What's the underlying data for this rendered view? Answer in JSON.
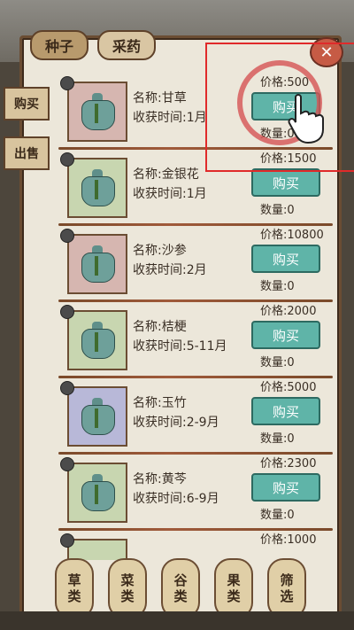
{
  "tabs": [
    {
      "label": "种子"
    },
    {
      "label": "采药"
    }
  ],
  "side_buttons": [
    {
      "label": "购买"
    },
    {
      "label": "出售"
    }
  ],
  "close_label": "✕",
  "items": [
    {
      "name": "名称:甘草",
      "time": "收获时间:1月",
      "price": "价格:500",
      "buy": "购买",
      "qty": "数量:0",
      "color": "#d6b6b0"
    },
    {
      "name": "名称:金银花",
      "time": "收获时间:1月",
      "price": "价格:1500",
      "buy": "购买",
      "qty": "数量:0",
      "color": "#c8d6b0"
    },
    {
      "name": "名称:沙参",
      "time": "收获时间:2月",
      "price": "价格:10800",
      "buy": "购买",
      "qty": "数量:0",
      "color": "#d6b6b0"
    },
    {
      "name": "名称:桔梗",
      "time": "收获时间:5-11月",
      "price": "价格:2000",
      "buy": "购买",
      "qty": "数量:0",
      "color": "#c8d6b0"
    },
    {
      "name": "名称:玉竹",
      "time": "收获时间:2-9月",
      "price": "价格:5000",
      "buy": "购买",
      "qty": "数量:0",
      "color": "#b8b8d8"
    },
    {
      "name": "名称:黄芩",
      "time": "收获时间:6-9月",
      "price": "价格:2300",
      "buy": "购买",
      "qty": "数量:0",
      "color": "#c8d6b0"
    },
    {
      "name": "",
      "time": "",
      "price": "价格:1000",
      "buy": "",
      "qty": "",
      "color": "#c8d6b0"
    }
  ],
  "categories": [
    {
      "l1": "草",
      "l2": "类"
    },
    {
      "l1": "菜",
      "l2": "类"
    },
    {
      "l1": "谷",
      "l2": "类"
    },
    {
      "l1": "果",
      "l2": "类"
    },
    {
      "l1": "筛",
      "l2": "选"
    }
  ]
}
